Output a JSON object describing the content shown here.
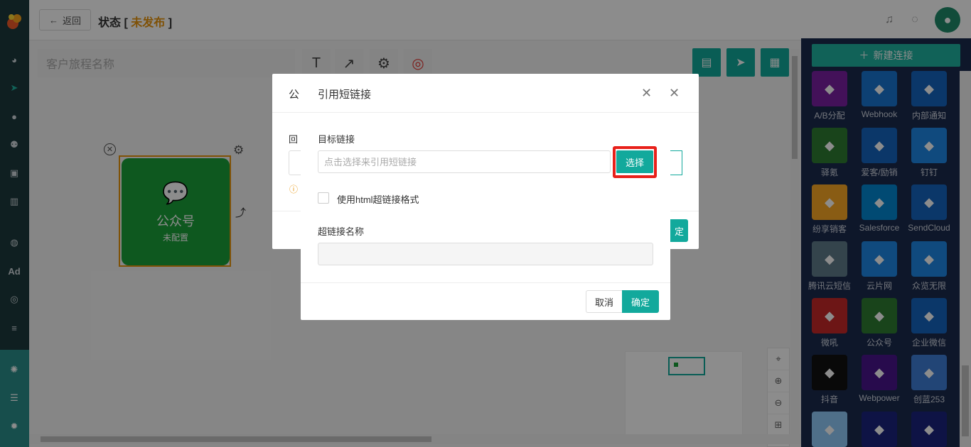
{
  "topbar": {
    "back_label": "返回",
    "status_prefix": "状态 [ ",
    "status_value": "未发布",
    "status_suffix": " ]"
  },
  "canvas": {
    "name_placeholder": "客户旅程名称",
    "node": {
      "title": "公众号",
      "subtitle": "未配置"
    }
  },
  "right_panel": {
    "new_connection_label": "新建连接",
    "connectors": [
      {
        "label": "A/B分配",
        "color": "#7a1fa2",
        "icon": "ab-split-icon"
      },
      {
        "label": "Webhook",
        "color": "#1976d2",
        "icon": "webhook-icon"
      },
      {
        "label": "内部通知",
        "color": "#1565c0",
        "icon": "bell-icon"
      },
      {
        "label": "驿氪",
        "color": "#2e7d32",
        "icon": "spider-icon"
      },
      {
        "label": "爱客/励销",
        "color": "#1565c0",
        "icon": "k-icon"
      },
      {
        "label": "钉钉",
        "color": "#1e88e5",
        "icon": "dingtalk-icon"
      },
      {
        "label": "纷享销客",
        "color": "#f9a825",
        "icon": "fxiaoke-icon"
      },
      {
        "label": "Salesforce",
        "color": "#0288d1",
        "icon": "cloud-icon"
      },
      {
        "label": "SendCloud",
        "color": "#1565c0",
        "icon": "sendcloud-icon"
      },
      {
        "label": "腾讯云短信",
        "color": "#607d8b",
        "icon": "tencent-cloud-icon"
      },
      {
        "label": "云片网",
        "color": "#1e88e5",
        "icon": "yunpian-icon"
      },
      {
        "label": "众览无限",
        "color": "#1e88e5",
        "icon": "zhonglan-icon"
      },
      {
        "label": "微吼",
        "color": "#c62828",
        "icon": "weihou-icon"
      },
      {
        "label": "公众号",
        "color": "#2e7d32",
        "icon": "wechat-icon"
      },
      {
        "label": "企业微信",
        "color": "#1565c0",
        "icon": "wecom-icon"
      },
      {
        "label": "抖音",
        "color": "#111111",
        "icon": "douyin-icon"
      },
      {
        "label": "Webpower",
        "color": "#4a148c",
        "icon": "webpower-icon"
      },
      {
        "label": "创蓝253",
        "color": "#3f7fd8",
        "icon": "chuanglan-icon"
      },
      {
        "label": "",
        "color": "#90caf9",
        "icon": "partial-icon"
      },
      {
        "label": "",
        "color": "#1a237e",
        "icon": "partial-icon"
      },
      {
        "label": "",
        "color": "#1a237e",
        "icon": "partial-icon"
      }
    ]
  },
  "back_dialog": {
    "title": "公",
    "label": "回",
    "ok_tail": "定"
  },
  "dialog": {
    "title": "引用短链接",
    "target_label": "目标链接",
    "link_placeholder": "点击选择来引用短链接",
    "select_button": "选择",
    "html_checkbox_label": "使用html超链接格式",
    "hyperlink_name_label": "超链接名称",
    "cancel_button": "取消",
    "ok_button": "确定"
  },
  "colors": {
    "teal": "#12a99c",
    "nav_dark": "#1c3a3d",
    "panel_navy": "#1b2a4e",
    "highlight_red": "#e8201a",
    "node_green": "#1ba13a",
    "status_orange": "#e8940c"
  }
}
